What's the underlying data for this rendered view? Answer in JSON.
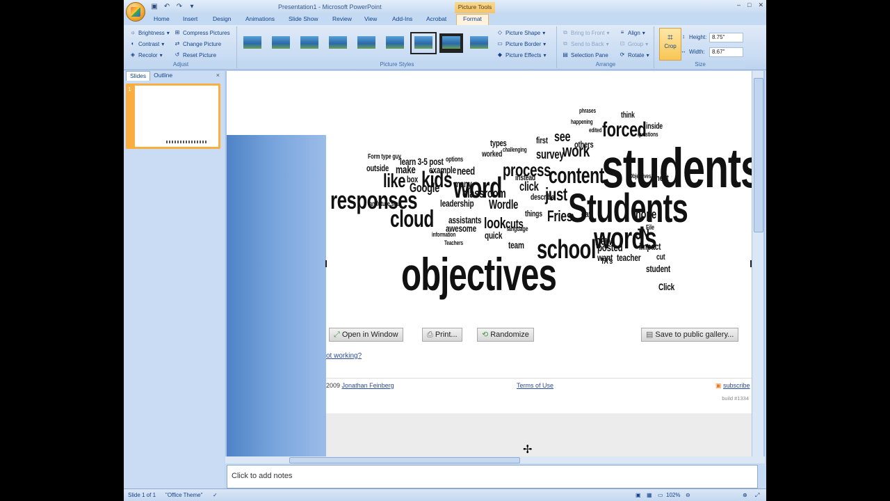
{
  "window": {
    "title": "Presentation1 - Microsoft PowerPoint",
    "context_tab": "Picture Tools",
    "controls": [
      "–",
      "□",
      "✕"
    ]
  },
  "ribbon_tabs": [
    "Home",
    "Insert",
    "Design",
    "Animations",
    "Slide Show",
    "Review",
    "View",
    "Add-Ins",
    "Acrobat",
    "Format"
  ],
  "adjust": {
    "brightness": "Brightness",
    "contrast": "Contrast",
    "recolor": "Recolor",
    "compress": "Compress Pictures",
    "change": "Change Picture",
    "reset": "Reset Picture",
    "label": "Adjust"
  },
  "picture_styles": {
    "shape": "Picture Shape",
    "border": "Picture Border",
    "effects": "Picture Effects",
    "label": "Picture Styles"
  },
  "arrange": {
    "bring_front": "Bring to Front",
    "send_back": "Send to Back",
    "selection_pane": "Selection Pane",
    "align": "Align",
    "group": "Group",
    "rotate": "Rotate",
    "label": "Arrange"
  },
  "size": {
    "crop": "Crop",
    "height_label": "Height:",
    "height_value": "8.75\"",
    "width_label": "Width:",
    "width_value": "8.67\"",
    "label": "Size"
  },
  "left_pane": {
    "tab_slides": "Slides",
    "tab_outline": "Outline",
    "close": "×",
    "slide_number": "1"
  },
  "wordle": {
    "open_window": "Open in Window",
    "print": "Print...",
    "randomize": "Randomize",
    "save_gallery": "Save to public gallery...",
    "not_working": "ot working?",
    "copyright": "2009",
    "author": "Jonathan Feinberg",
    "terms": "Terms of Use",
    "subscribe": "subscribe",
    "build": "build #1334"
  },
  "notes_placeholder": "Click to add notes",
  "status": {
    "slide": "Slide 1 of 1",
    "theme": "\"Office Theme\"",
    "zoom": "102%"
  }
}
